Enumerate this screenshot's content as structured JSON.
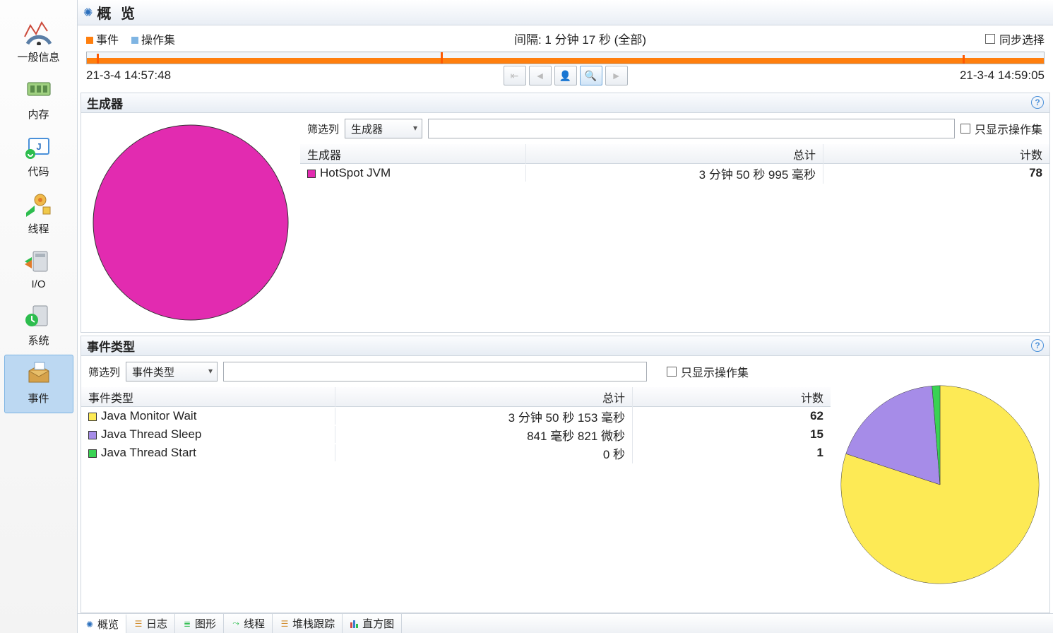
{
  "sidebar": {
    "items": [
      {
        "label": "一般信息"
      },
      {
        "label": "内存"
      },
      {
        "label": "代码"
      },
      {
        "label": "线程"
      },
      {
        "label": "I/O"
      },
      {
        "label": "系统"
      },
      {
        "label": "事件"
      }
    ]
  },
  "header": {
    "title": "概 览"
  },
  "legend": {
    "events": "事件",
    "ops": "操作集"
  },
  "interval": "间隔: 1 分钟 17 秒 (全部)",
  "sync": "同步选择",
  "time_start": "21-3-4 14:57:48",
  "time_end": "21-3-4 14:59:05",
  "gen": {
    "title": "生成器",
    "filter_label": "筛选列",
    "filter_select": "生成器",
    "only_ops": "只显示操作集",
    "cols": {
      "a": "生成器",
      "b": "总计",
      "c": "计数"
    },
    "rows": [
      {
        "name": "HotSpot JVM",
        "total": "3 分钟 50 秒 995 毫秒",
        "count": "78",
        "color": "#e22bb0"
      }
    ]
  },
  "evt": {
    "title": "事件类型",
    "filter_label": "筛选列",
    "filter_select": "事件类型",
    "only_ops": "只显示操作集",
    "cols": {
      "a": "事件类型",
      "b": "总计",
      "c": "计数"
    },
    "rows": [
      {
        "name": "Java Monitor Wait",
        "total": "3 分钟 50 秒 153 毫秒",
        "count": "62",
        "color": "#fdea55"
      },
      {
        "name": "Java Thread Sleep",
        "total": "841 毫秒 821 微秒",
        "count": "15",
        "color": "#a68ce8"
      },
      {
        "name": "Java Thread Start",
        "total": "0 秒",
        "count": "1",
        "color": "#39d353"
      }
    ]
  },
  "tabs": [
    {
      "label": "概览"
    },
    {
      "label": "日志"
    },
    {
      "label": "图形"
    },
    {
      "label": "线程"
    },
    {
      "label": "堆栈跟踪"
    },
    {
      "label": "直方图"
    }
  ],
  "chart_data": [
    {
      "type": "pie",
      "title": "生成器",
      "series": [
        {
          "name": "HotSpot JVM",
          "value": 78,
          "color": "#e22bb0"
        }
      ]
    },
    {
      "type": "pie",
      "title": "事件类型",
      "series": [
        {
          "name": "Java Monitor Wait",
          "value": 62,
          "color": "#fdea55"
        },
        {
          "name": "Java Thread Sleep",
          "value": 15,
          "color": "#a68ce8"
        },
        {
          "name": "Java Thread Start",
          "value": 1,
          "color": "#39d353"
        }
      ]
    }
  ]
}
